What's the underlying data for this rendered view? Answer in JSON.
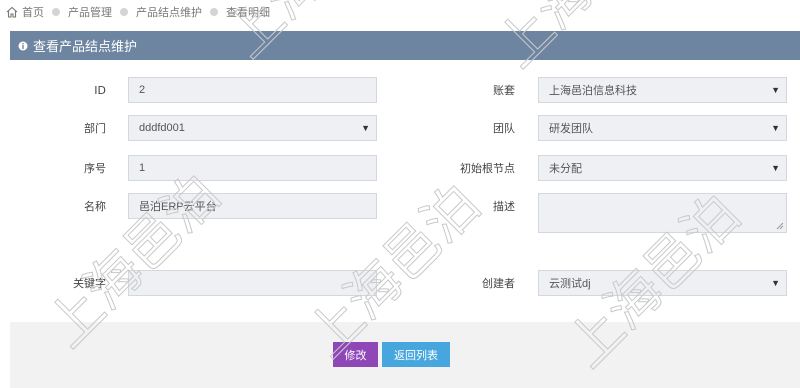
{
  "breadcrumb": {
    "items": [
      "首页",
      "产品管理",
      "产品结点维护",
      "查看明细"
    ]
  },
  "panel": {
    "title": "查看产品结点维护"
  },
  "form": {
    "id": {
      "label": "ID",
      "value": "2"
    },
    "account": {
      "label": "账套",
      "value": "上海邑泊信息科技"
    },
    "department": {
      "label": "部门",
      "value": "dddfd001"
    },
    "team": {
      "label": "团队",
      "value": "研发团队"
    },
    "seq": {
      "label": "序号",
      "value": "1"
    },
    "root_node": {
      "label": "初始根节点",
      "value": "未分配"
    },
    "name": {
      "label": "名称",
      "value": "邑泊ERP云平台"
    },
    "description": {
      "label": "描述",
      "value": ""
    },
    "keywords": {
      "label": "关键字",
      "value": ""
    },
    "creator": {
      "label": "创建者",
      "value": "云测试dj"
    }
  },
  "buttons": {
    "edit": "修改",
    "back": "返回列表"
  },
  "watermark": {
    "text": "上海邑泊"
  },
  "colors": {
    "header": "#6e85a1",
    "edit_button": "#8f47b8",
    "back_button": "#46a6dd",
    "field_bg": "#eef0f4"
  }
}
